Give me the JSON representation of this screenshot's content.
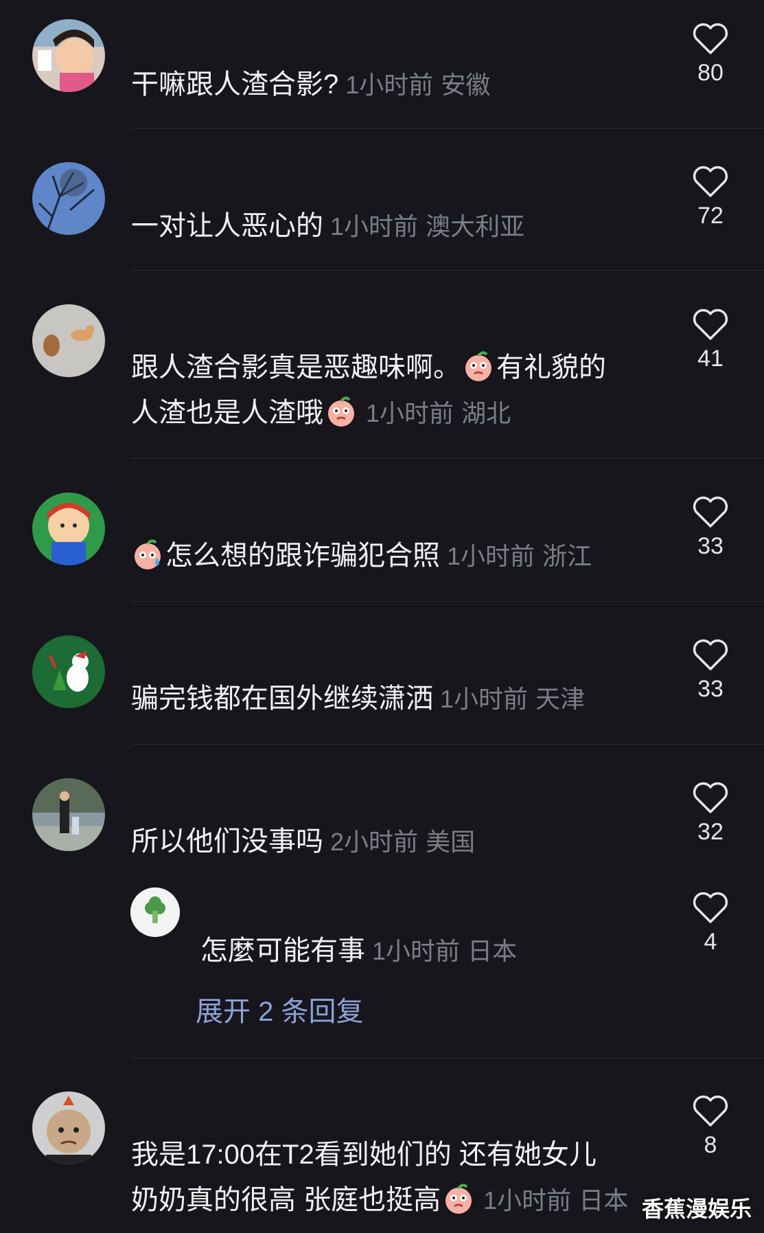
{
  "comments": [
    {
      "text": "干嘛跟人渣合影?",
      "time": "1小时前",
      "location": "安徽",
      "likes": "80"
    },
    {
      "text": "一对让人恶心的",
      "time": "1小时前",
      "location": "澳大利亚",
      "likes": "72"
    },
    {
      "text_line1": "跟人渣合影真是恶趣味啊。",
      "text_line1b": "有礼貌的",
      "text_line2": "人渣也是人渣哦",
      "time": "1小时前",
      "location": "湖北",
      "likes": "41"
    },
    {
      "text": "怎么想的跟诈骗犯合照",
      "time": "1小时前",
      "location": "浙江",
      "likes": "33"
    },
    {
      "text": "骗完钱都在国外继续潇洒",
      "time": "1小时前",
      "location": "天津",
      "likes": "33"
    },
    {
      "text": "所以他们没事吗",
      "time": "2小时前",
      "location": "美国",
      "likes": "32"
    },
    {
      "text_line1": "我是17:00在T2看到她们的 还有她女儿",
      "text_line2": "奶奶真的很高 张庭也挺高",
      "time": "1小时前",
      "location": "日本",
      "likes": "8"
    }
  ],
  "reply": {
    "text": "怎麼可能有事",
    "time": "1小时前",
    "location": "日本",
    "likes": "4"
  },
  "expand_replies": "展开 2 条回复",
  "watermark": "香蕉漫娱乐",
  "colors": {
    "background": "#16161c",
    "meta": "#7d7d86",
    "link": "#8ea2d6"
  }
}
